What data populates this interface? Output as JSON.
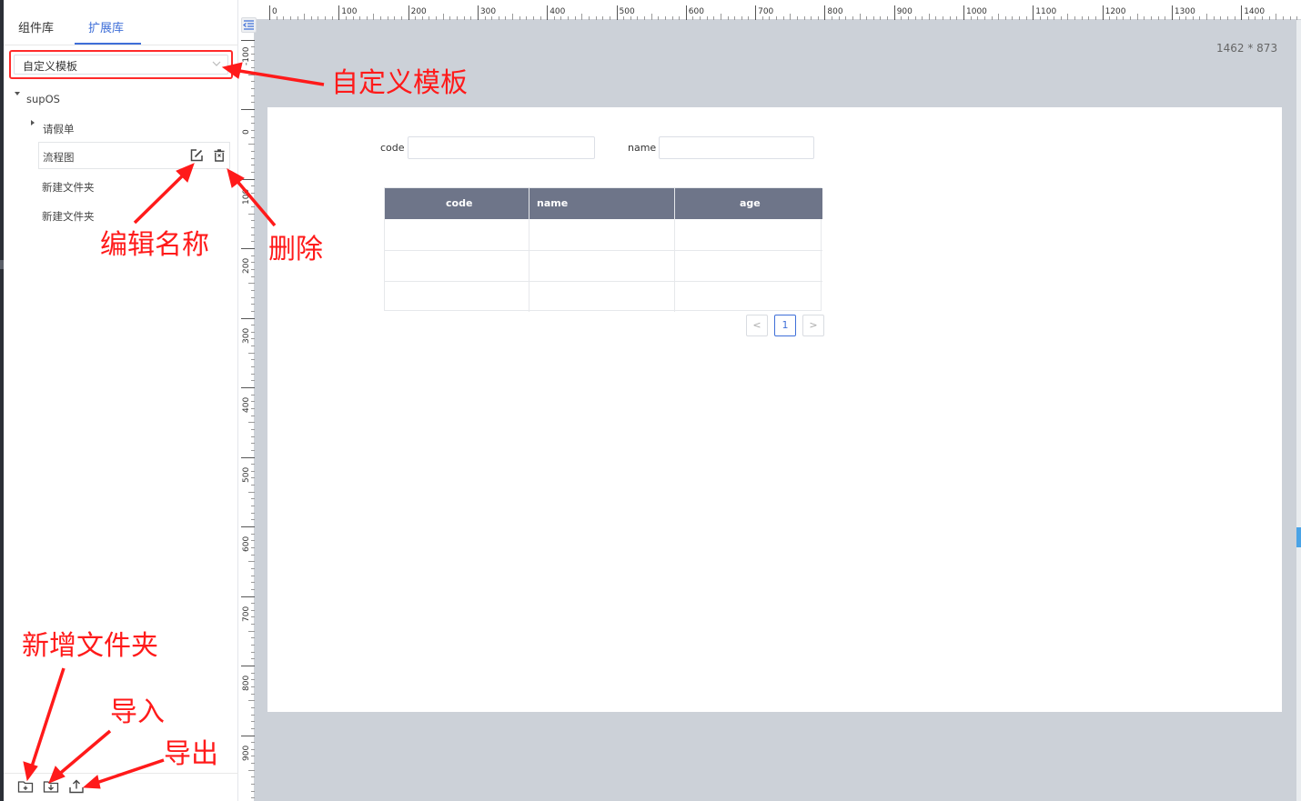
{
  "sidebar": {
    "tabs": [
      {
        "label": "组件库",
        "active": false
      },
      {
        "label": "扩展库",
        "active": true
      }
    ],
    "template_select": {
      "value": "自定义模板"
    },
    "tree": {
      "root": "supOS",
      "child": "请假单",
      "active_item": "流程图",
      "folders": [
        "新建文件夹",
        "新建文件夹"
      ]
    },
    "bottom_icons": [
      "add-folder-icon",
      "import-icon",
      "export-icon"
    ]
  },
  "ruler": {
    "top_labels": [
      "0",
      "100",
      "200",
      "300",
      "400",
      "500",
      "600",
      "700",
      "800",
      "900",
      "1000",
      "1100",
      "1200",
      "1300",
      "1400"
    ],
    "left_labels": [
      "-100",
      "0",
      "100",
      "200",
      "300",
      "400",
      "500",
      "600",
      "700",
      "800",
      "900"
    ]
  },
  "canvas": {
    "size_label": "1462 * 873",
    "form": {
      "code_label": "code",
      "name_label": "name",
      "code_value": "",
      "name_value": ""
    },
    "table": {
      "columns": [
        "code",
        "name",
        "age"
      ],
      "rows": [
        [
          "",
          "",
          ""
        ],
        [
          "",
          "",
          ""
        ],
        [
          "",
          "",
          ""
        ]
      ]
    },
    "pagination": {
      "prev": "<",
      "current": "1",
      "next": ">"
    }
  },
  "annotations": {
    "custom_template": "自定义模板",
    "edit_name": "编辑名称",
    "delete": "删除",
    "new_folder": "新增文件夹",
    "import": "导入",
    "export": "导出"
  },
  "colors": {
    "accent": "#3f6fd8",
    "annotation_red": "#ff1a1a",
    "table_header": "#6e7589",
    "workspace_bg": "#ccd1d8"
  }
}
